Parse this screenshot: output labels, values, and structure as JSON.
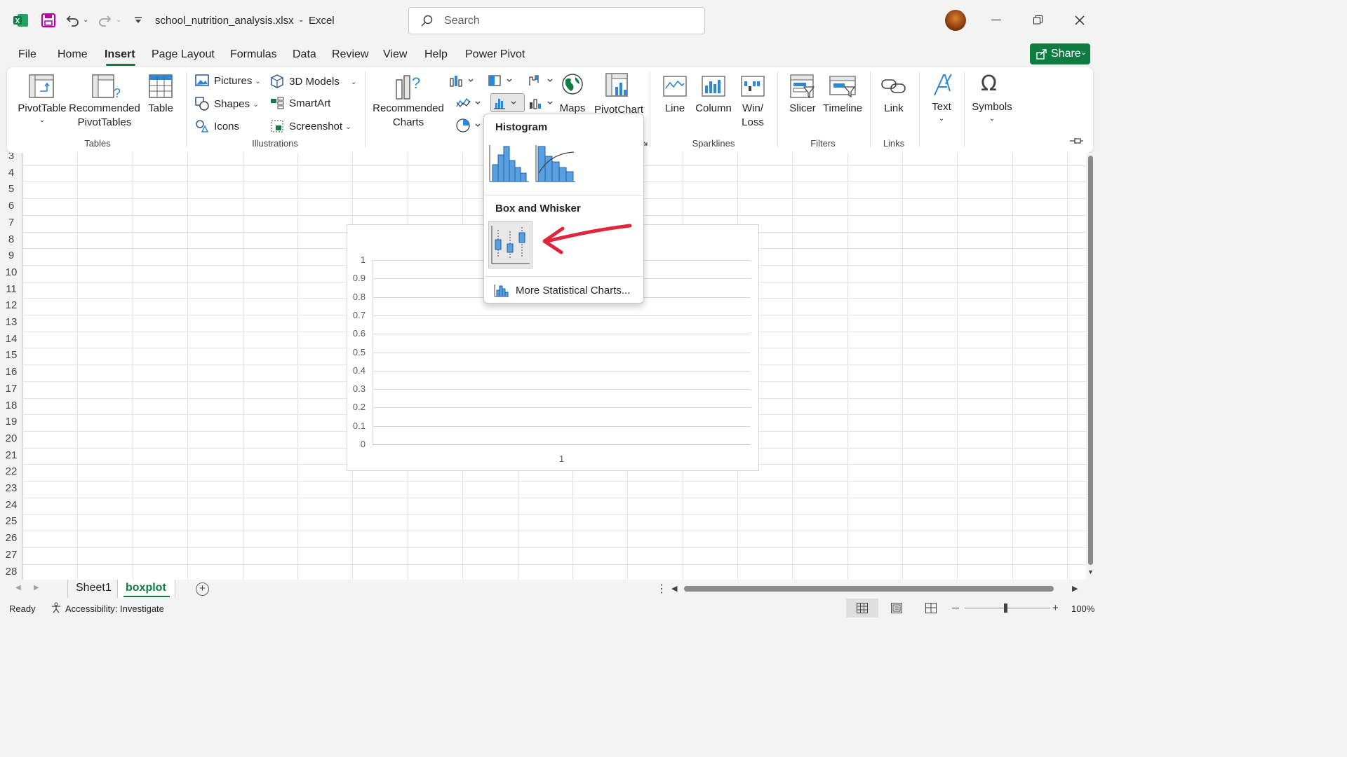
{
  "titlebar": {
    "filename": "school_nutrition_analysis.xlsx",
    "separator": "-",
    "app": "Excel",
    "search_placeholder": "Search",
    "window_controls": [
      "minimize-icon",
      "restore-icon",
      "close-icon"
    ]
  },
  "tabs": [
    "File",
    "Home",
    "Insert",
    "Page Layout",
    "Formulas",
    "Data",
    "Review",
    "View",
    "Help",
    "Power Pivot"
  ],
  "active_tab": "Insert",
  "share_label": "Share",
  "ribbon": {
    "tables": {
      "pivottable": "PivotTable",
      "recommended_pivot_1": "Recommended",
      "recommended_pivot_2": "PivotTables",
      "table": "Table",
      "group": "Tables"
    },
    "illustrations": {
      "pictures": "Pictures",
      "shapes": "Shapes",
      "icons": "Icons",
      "models": "3D Models",
      "smartart": "SmartArt",
      "screenshot": "Screenshot",
      "group": "Illustrations"
    },
    "charts": {
      "recommended_1": "Recommended",
      "recommended_2": "Charts",
      "maps": "Maps",
      "pivotchart": "PivotChart"
    },
    "sparklines": {
      "line": "Line",
      "column": "Column",
      "winloss_1": "Win/",
      "winloss_2": "Loss",
      "group": "Sparklines"
    },
    "filters": {
      "slicer": "Slicer",
      "timeline": "Timeline",
      "group": "Filters"
    },
    "links": {
      "link": "Link",
      "group": "Links"
    },
    "text": {
      "text": "Text"
    },
    "symbols": {
      "symbols": "Symbols"
    }
  },
  "dropdown": {
    "histogram_header": "Histogram",
    "boxwhisker_header": "Box and Whisker",
    "more": "More Statistical Charts..."
  },
  "rows": [
    "3",
    "4",
    "5",
    "6",
    "7",
    "8",
    "9",
    "10",
    "11",
    "12",
    "13",
    "14",
    "15",
    "16",
    "17",
    "18",
    "19",
    "20",
    "21",
    "22",
    "23",
    "24",
    "25",
    "26",
    "27",
    "28"
  ],
  "chart_data": {
    "type": "bar",
    "categories": [
      "1"
    ],
    "values": [],
    "ylim": [
      0,
      1
    ],
    "yticks": [
      "1",
      "0.9",
      "0.8",
      "0.7",
      "0.6",
      "0.5",
      "0.4",
      "0.3",
      "0.2",
      "0.1",
      "0"
    ],
    "grid": true
  },
  "sheets": [
    "Sheet1",
    "boxplot"
  ],
  "active_sheet": "boxplot",
  "status": {
    "ready": "Ready",
    "accessibility": "Accessibility: Investigate",
    "zoom": "100%"
  },
  "colors": {
    "excel_green": "#107c41",
    "accent_blue": "#2b88d8",
    "arrow_red": "#e0243b"
  }
}
